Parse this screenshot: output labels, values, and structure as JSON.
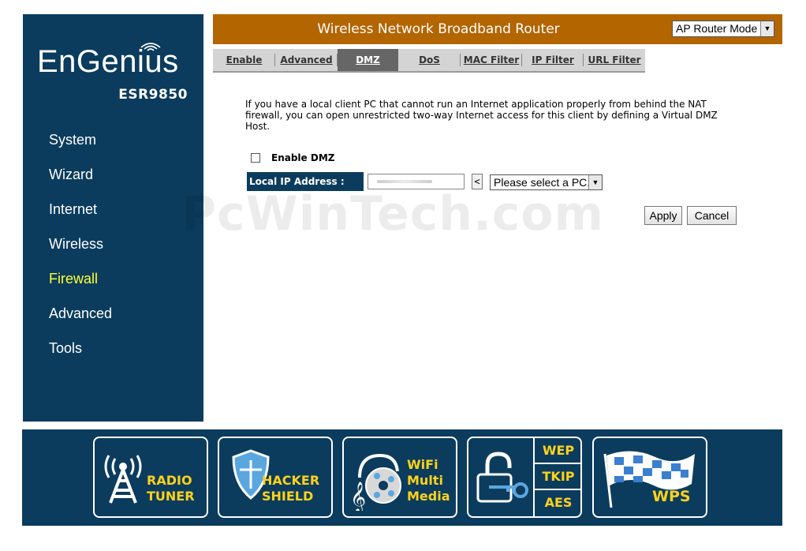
{
  "brand": {
    "name": "EnGenius",
    "model": "ESR9850"
  },
  "nav": [
    {
      "label": "System",
      "active": false
    },
    {
      "label": "Wizard",
      "active": false
    },
    {
      "label": "Internet",
      "active": false
    },
    {
      "label": "Wireless",
      "active": false
    },
    {
      "label": "Firewall",
      "active": true
    },
    {
      "label": "Advanced",
      "active": false
    },
    {
      "label": "Tools",
      "active": false
    }
  ],
  "header": {
    "title": "Wireless Network Broadband Router",
    "mode": "AP Router Mode"
  },
  "tabs": [
    {
      "label": "Enable",
      "active": false
    },
    {
      "label": "Advanced",
      "active": false
    },
    {
      "label": "DMZ",
      "active": true
    },
    {
      "label": "DoS",
      "active": false
    },
    {
      "label": "MAC Filter",
      "active": false
    },
    {
      "label": "IP Filter",
      "active": false
    },
    {
      "label": "URL Filter",
      "active": false
    }
  ],
  "content": {
    "description": "If you have a local client PC that cannot run an Internet application properly from behind the NAT firewall, you can open unrestricted two-way Internet access for this client by defining a Virtual DMZ Host.",
    "enable_dmz_label": "Enable DMZ",
    "enable_dmz_checked": false,
    "ip_label": "Local IP Address :",
    "ip_value": "",
    "copy_label": "<",
    "pc_select": "Please select a PC.",
    "apply_label": "Apply",
    "cancel_label": "Cancel"
  },
  "watermark": "PcWinTech.com",
  "banner": {
    "radio": {
      "line1": "RADIO",
      "line2": "TUNER"
    },
    "shield": {
      "line1": "HACKER",
      "line2": "SHIELD"
    },
    "media": {
      "line1": "WiFi",
      "line2": "Multi",
      "line3": "Media"
    },
    "security": [
      "WEP",
      "TKIP",
      "AES"
    ],
    "wps": "WPS"
  },
  "colors": {
    "sidebar": "#0b3c5d",
    "header": "#b36500",
    "active_nav": "#ffff33",
    "banner_text": "#ffd21a",
    "active_tab": "#666666"
  }
}
